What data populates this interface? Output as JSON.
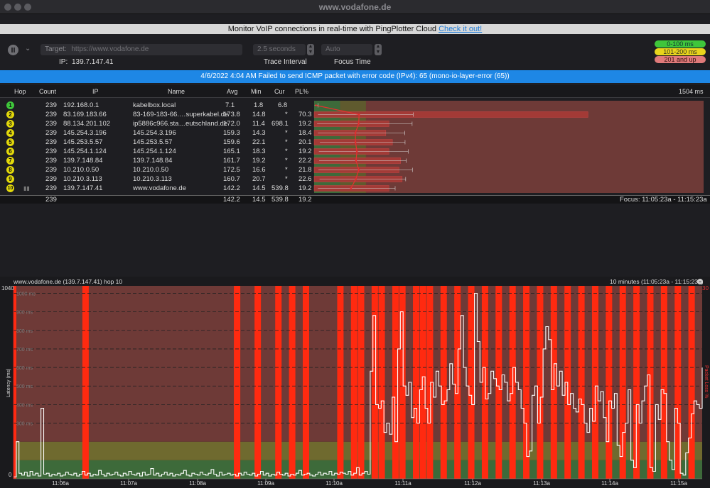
{
  "window": {
    "title": "www.vodafone.de"
  },
  "promo": {
    "text": "Monitor VoIP connections in real-time with PingPlotter Cloud",
    "link": "Check it out!"
  },
  "toolbar": {
    "target_label": "Target:",
    "target_placeholder": "https://www.vodafone.de",
    "interval_value": "2.5 seconds",
    "interval_label": "Trace Interval",
    "focus_value": "Auto",
    "focus_label": "Focus Time",
    "ip_label": "IP:",
    "ip_value": "139.7.147.41"
  },
  "legend": [
    {
      "label": "0-100 ms",
      "color": "#3fc63b"
    },
    {
      "label": "101-200 ms",
      "color": "#e8d51c"
    },
    {
      "label": "201 and up",
      "color": "#e07a7a"
    }
  ],
  "alert": "4/6/2022 4:04 AM Failed to send ICMP packet with error code (IPv4): 65 (mono-io-layer-error (65))",
  "table": {
    "headers": {
      "hop": "Hop",
      "count": "Count",
      "ip": "IP",
      "name": "Name",
      "avg": "Avg",
      "min": "Min",
      "cur": "Cur",
      "pl": "PL%",
      "scale": "1504 ms"
    },
    "rows": [
      {
        "hop": "1",
        "count": "239",
        "ip": "192.168.0.1",
        "name": "kabelbox.local",
        "avg": "7.1",
        "min": "1.8",
        "cur": "6.8",
        "pl": ""
      },
      {
        "hop": "2",
        "count": "239",
        "ip": "83.169.183.66",
        "name": "83-169-183-66.…superkabel.de",
        "avg": "173.8",
        "min": "14.8",
        "cur": "*",
        "pl": "70.3"
      },
      {
        "hop": "3",
        "count": "239",
        "ip": "88.134.201.102",
        "name": "ip5886c966.sta…eutschland.de",
        "avg": "172.0",
        "min": "11.4",
        "cur": "698.1",
        "pl": "19.2"
      },
      {
        "hop": "4",
        "count": "239",
        "ip": "145.254.3.196",
        "name": "145.254.3.196",
        "avg": "159.3",
        "min": "14.3",
        "cur": "*",
        "pl": "18.4"
      },
      {
        "hop": "5",
        "count": "239",
        "ip": "145.253.5.57",
        "name": "145.253.5.57",
        "avg": "159.6",
        "min": "22.1",
        "cur": "*",
        "pl": "20.1"
      },
      {
        "hop": "6",
        "count": "239",
        "ip": "145.254.1.124",
        "name": "145.254.1.124",
        "avg": "165.1",
        "min": "18.3",
        "cur": "*",
        "pl": "19.2"
      },
      {
        "hop": "7",
        "count": "239",
        "ip": "139.7.148.84",
        "name": "139.7.148.84",
        "avg": "161.7",
        "min": "19.2",
        "cur": "*",
        "pl": "22.2"
      },
      {
        "hop": "8",
        "count": "239",
        "ip": "10.210.0.50",
        "name": "10.210.0.50",
        "avg": "172.5",
        "min": "16.6",
        "cur": "*",
        "pl": "21.8"
      },
      {
        "hop": "9",
        "count": "239",
        "ip": "10.210.3.113",
        "name": "10.210.3.113",
        "avg": "160.7",
        "min": "20.7",
        "cur": "*",
        "pl": "22.6"
      },
      {
        "hop": "10",
        "count": "239",
        "ip": "139.7.147.41",
        "name": "www.vodafone.de",
        "avg": "142.2",
        "min": "14.5",
        "cur": "539.8",
        "pl": "19.2"
      }
    ],
    "totals": {
      "count": "239",
      "avg": "142.2",
      "min": "14.5",
      "cur": "539.8",
      "pl": "19.2",
      "focus": "Focus: 11:05:23a - 11:15:23a"
    }
  },
  "timeline": {
    "target": "www.vodafone.de (139.7.147.41) hop 10",
    "range": "10 minutes (11:05:23a - 11:15:23a)",
    "ymax_label": "1040",
    "yzero_label": "0",
    "ylabel": "Latency (ms)",
    "pl_label": "Packet Loss %",
    "pl_max": "30",
    "y_ticks": [
      "1000 ms",
      "900 ms",
      "800 ms",
      "700 ms",
      "600 ms",
      "500 ms",
      "400 ms",
      "300 ms"
    ],
    "x_ticks": [
      "11:06a",
      "11:07a",
      "11:08a",
      "11:09a",
      "11:10a",
      "11:11a",
      "11:12a",
      "11:13a",
      "11:14a",
      "11:15a"
    ]
  },
  "chart_data": {
    "type": "line",
    "title": "www.vodafone.de (139.7.147.41) hop 10",
    "ylabel": "Latency (ms)",
    "ylim": [
      0,
      1040
    ],
    "x_start": "11:05:23a",
    "x_end": "11:15:23a",
    "x_labels": [
      "11:06a",
      "11:07a",
      "11:08a",
      "11:09a",
      "11:10a",
      "11:11a",
      "11:12a",
      "11:13a",
      "11:14a",
      "11:15a"
    ],
    "bands": [
      {
        "range": [
          0,
          100
        ],
        "color": "#3d6a3a"
      },
      {
        "range": [
          100,
          200
        ],
        "color": "#6f6a2f"
      },
      {
        "range": [
          200,
          1040
        ],
        "color": "#6e3a37"
      }
    ],
    "series": [
      {
        "name": "Latency",
        "color": "#ffffff",
        "values": [
          10,
          200,
          30,
          20,
          35,
          15,
          40,
          20,
          30,
          15,
          380,
          25,
          30,
          15,
          25,
          20,
          30,
          15,
          20,
          35,
          25,
          20,
          30,
          15,
          25,
          40,
          20,
          30,
          15,
          25,
          20,
          45,
          25,
          15,
          30,
          20,
          25,
          35,
          20,
          15,
          30,
          20,
          40,
          25,
          20,
          30,
          15,
          35,
          20,
          25,
          55,
          20,
          30,
          15,
          25,
          35,
          20,
          30,
          15,
          25,
          20,
          30,
          45,
          20,
          15,
          30,
          25,
          20,
          35,
          25,
          20,
          30,
          50,
          25,
          15,
          35,
          20,
          25,
          30,
          20,
          25,
          15,
          30,
          20,
          35,
          25,
          20,
          30,
          15,
          25,
          40,
          20,
          30,
          15,
          25,
          20,
          35,
          25,
          20,
          30,
          15,
          25,
          20,
          30,
          45,
          20,
          25,
          30,
          20,
          15,
          25,
          35,
          20,
          30,
          25,
          40,
          20,
          30,
          25,
          35,
          30,
          25,
          40,
          20,
          30,
          60,
          20,
          30,
          40,
          25,
          580,
          880,
          400,
          380,
          420,
          250,
          300,
          240,
          440,
          200,
          700,
          900,
          500,
          450,
          520,
          330,
          380,
          300,
          480,
          550,
          380,
          300,
          520,
          440,
          580,
          500,
          400,
          420,
          480,
          620,
          510,
          460,
          700,
          880,
          600,
          500,
          450,
          400,
          1000,
          740,
          520,
          600,
          430,
          460,
          580,
          540,
          500,
          480,
          560,
          520,
          420,
          460,
          600,
          520,
          480,
          380,
          300,
          120,
          150,
          450,
          500,
          300,
          440,
          700,
          820,
          750,
          480,
          620,
          500,
          580,
          450,
          520,
          400,
          460,
          380,
          360,
          430,
          400,
          300,
          250,
          380,
          310,
          500,
          420,
          470,
          330,
          200,
          420,
          380,
          460,
          180,
          120,
          250,
          300,
          480,
          100,
          60,
          400,
          300,
          420,
          500,
          560,
          60,
          40,
          400,
          320,
          480,
          460,
          200,
          100,
          50,
          380,
          300,
          30,
          20,
          140,
          220,
          350,
          420,
          400,
          380,
          600
        ]
      }
    ],
    "packet_loss_columns_pct": [
      0,
      10,
      32,
      35,
      38,
      40,
      42,
      47,
      49,
      50,
      52,
      53,
      55,
      56,
      58,
      59,
      60,
      62,
      64,
      66,
      68,
      70,
      72,
      74,
      76,
      78,
      80,
      82,
      84,
      86,
      88,
      90,
      92,
      94,
      96,
      98
    ]
  }
}
